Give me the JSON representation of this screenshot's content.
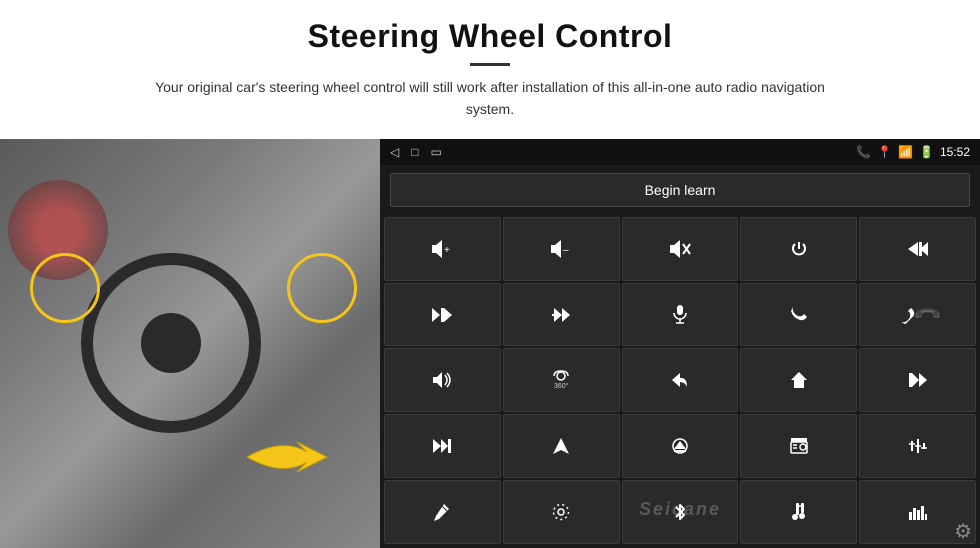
{
  "header": {
    "title": "Steering Wheel Control",
    "subtitle": "Your original car's steering wheel control will still work after installation of this all-in-one auto radio navigation system."
  },
  "status_bar": {
    "time": "15:52",
    "nav_back": "◁",
    "nav_home": "□",
    "nav_recent": "▭",
    "signal_icon": "📶"
  },
  "begin_learn": {
    "label": "Begin learn"
  },
  "grid_buttons": [
    {
      "icon": "🔊+",
      "name": "vol-up"
    },
    {
      "icon": "🔊–",
      "name": "vol-down"
    },
    {
      "icon": "🔇",
      "name": "mute"
    },
    {
      "icon": "⏻",
      "name": "power"
    },
    {
      "icon": "⏮",
      "name": "prev-track-right"
    },
    {
      "icon": "⏭",
      "name": "next"
    },
    {
      "icon": "⏪⏩",
      "name": "fast-rewind-forward"
    },
    {
      "icon": "🎤",
      "name": "mic"
    },
    {
      "icon": "📞",
      "name": "call"
    },
    {
      "icon": "📵",
      "name": "end-call"
    },
    {
      "icon": "📢",
      "name": "announce"
    },
    {
      "icon": "360°",
      "name": "camera-360"
    },
    {
      "icon": "↩",
      "name": "back"
    },
    {
      "icon": "⌂",
      "name": "home"
    },
    {
      "icon": "⏮⏮",
      "name": "skip-back"
    },
    {
      "icon": "⏭",
      "name": "skip-next"
    },
    {
      "icon": "▶",
      "name": "play"
    },
    {
      "icon": "⊜",
      "name": "eject"
    },
    {
      "icon": "📷",
      "name": "camera"
    },
    {
      "icon": "🎛",
      "name": "equalizer"
    },
    {
      "icon": "🖊",
      "name": "edit"
    },
    {
      "icon": "⊙",
      "name": "target"
    },
    {
      "icon": "✴",
      "name": "bluetooth"
    },
    {
      "icon": "🎵",
      "name": "music"
    },
    {
      "icon": "📊",
      "name": "spectrum"
    }
  ],
  "watermark": {
    "text": "Seicane"
  },
  "settings": {
    "icon": "⚙"
  }
}
